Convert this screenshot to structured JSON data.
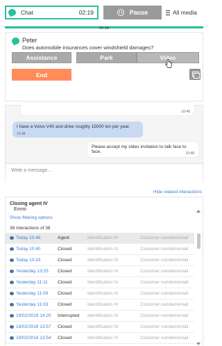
{
  "topbar": {
    "chat_label": "Chat",
    "chat_time": "02:19",
    "pause_label": "Pause",
    "allmedia_label": "All media",
    "progress_time": "02:18"
  },
  "conversation": {
    "name": "Peter",
    "question": "Does automobile insurances cover windshield damages?",
    "buttons": {
      "assistance": "Assistance",
      "park": "Park",
      "video": "Video",
      "end": "End"
    }
  },
  "chat": {
    "messages": [
      {
        "text": "...",
        "time": "10:48",
        "direction": "out"
      },
      {
        "text": "I have a Volvo V40 and drive roughly 15000 km per year.",
        "time": "10:48",
        "direction": "in"
      },
      {
        "text": "Please accept my video invitation to talk face to face.",
        "time": "10:48",
        "direction": "out"
      }
    ],
    "compose_placeholder": "Write a message..."
  },
  "related": {
    "hide_link": "Hide related interactions",
    "closing_label": "Closing agent IV",
    "closing_name": "Emmi",
    "filter_link": "Show filtering options",
    "count": "38 interactions of 38",
    "rows": [
      {
        "date": "Today 10:46",
        "status": "Agent",
        "ident": "Identification IV",
        "cust": "Customer number/email"
      },
      {
        "date": "Today 10:40",
        "status": "Closed",
        "ident": "Identification IV",
        "cust": "Customer number/email"
      },
      {
        "date": "Today 10:33",
        "status": "Closed",
        "ident": "Identification IV",
        "cust": "Customer number/email"
      },
      {
        "date": "Yesterday 13:25",
        "status": "Closed",
        "ident": "Identification IV",
        "cust": "Customer number/email"
      },
      {
        "date": "Yesterday 11:11",
        "status": "Closed",
        "ident": "Identification IV",
        "cust": "Customer number/email"
      },
      {
        "date": "Yesterday 11:09",
        "status": "Closed",
        "ident": "Identification IV",
        "cust": "Customer number/email"
      },
      {
        "date": "Yesterday 11:03",
        "status": "Closed",
        "ident": "Identification IV",
        "cust": "Customer number/email"
      },
      {
        "date": "19/02/2018 14:20",
        "status": "Interrupted",
        "ident": "Identification IV",
        "cust": "Customer number/email"
      },
      {
        "date": "19/02/2018 13:57",
        "status": "Closed",
        "ident": "Identification IV",
        "cust": "Customer number/email"
      },
      {
        "date": "19/02/2018 13:54",
        "status": "Closed",
        "ident": "Identification IV",
        "cust": "Customer number/email"
      }
    ]
  },
  "colors": {
    "accent": "#2bbf9e",
    "link": "#3b7dd8",
    "end_button": "#ff8c5a",
    "grey_button": "#a9a9a9",
    "incoming_bubble": "#c8d9f4"
  }
}
